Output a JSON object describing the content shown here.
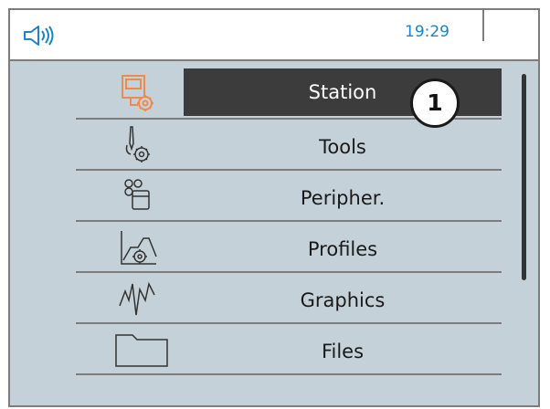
{
  "status_bar": {
    "time": "19:29",
    "sound_icon": "speaker-icon"
  },
  "menu": {
    "items": [
      {
        "label": "Station",
        "icon": "station-settings-icon",
        "selected": true
      },
      {
        "label": "Tools",
        "icon": "tools-settings-icon",
        "selected": false
      },
      {
        "label": "Peripher.",
        "icon": "peripherals-icon",
        "selected": false
      },
      {
        "label": "Profiles",
        "icon": "profiles-settings-icon",
        "selected": false
      },
      {
        "label": "Graphics",
        "icon": "graphics-icon",
        "selected": false
      },
      {
        "label": "Files",
        "icon": "folder-icon",
        "selected": false
      }
    ]
  },
  "callout": {
    "number": "1"
  },
  "colors": {
    "selected_bg": "#3c3c3c",
    "screen_bg": "#c5d1d8",
    "accent_orange": "#f08a4b",
    "time_blue": "#1a85cc"
  }
}
